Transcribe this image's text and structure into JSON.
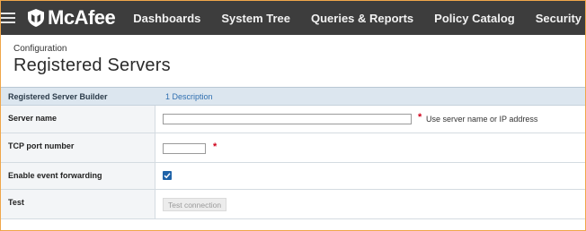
{
  "app": {
    "brand": "McAfee",
    "nav_items": [
      "Dashboards",
      "System Tree",
      "Queries & Reports",
      "Policy Catalog",
      "Security Resources"
    ]
  },
  "page": {
    "breadcrumb": "Configuration",
    "title": "Registered Servers"
  },
  "builder": {
    "header_label": "Registered Server Builder",
    "step_label": "1 Description"
  },
  "form": {
    "server_name": {
      "label": "Server name",
      "value": "",
      "required_mark": "*",
      "hint": "Use server name or IP address"
    },
    "tcp_port": {
      "label": "TCP port number",
      "value": "",
      "required_mark": "*"
    },
    "event_forwarding": {
      "label": "Enable event forwarding",
      "checked": true
    },
    "test": {
      "label": "Test",
      "button_label": "Test connection"
    }
  },
  "colors": {
    "nav_bg": "#3d3d3d",
    "accent_blue": "#1f63a8",
    "required_red": "#d0021b",
    "section_header_bg": "#dce6ef",
    "frame_border": "#f0a64a"
  }
}
